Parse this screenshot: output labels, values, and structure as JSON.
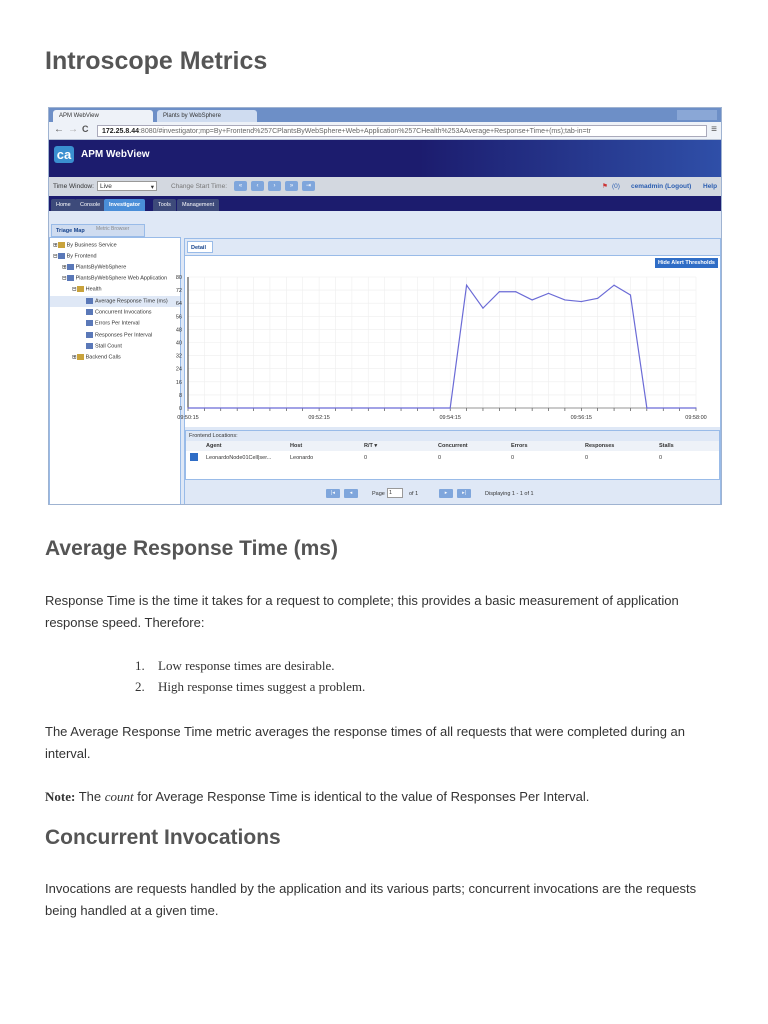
{
  "page_title": "Introscope Metrics",
  "screenshot": {
    "browser_tabs": [
      "APM WebView",
      "Plants by WebSphere"
    ],
    "url_host": "172.25.8.44",
    "url_rest": ":8080/#investigator;mp=By+Frontend%257CPlantsByWebSphere+Web+Application%257CHealth%253AAverage+Response+Time+(ms);tab-in=tr",
    "logo_text": "ca",
    "app_title": "APM WebView",
    "toolbar": {
      "time_window_label": "Time Window:",
      "time_window_value": "Live",
      "change_start_label": "Change Start Time:",
      "alerts": "(0)",
      "user": "cemadmin",
      "logout": "(Logout)",
      "help": "Help"
    },
    "nav_tabs": [
      "Home",
      "Console",
      "Investigator",
      "Tools",
      "Management"
    ],
    "side_tabs": [
      "Triage Map",
      "Metric Browser"
    ],
    "tree": [
      "By Business Service",
      "By Frontend",
      "PlantsByWebSphere",
      "PlantsByWebSphere Web Application",
      "Health",
      "Average Response Time (ms)",
      "Concurrent Invocations",
      "Errors Per Interval",
      "Responses Per Interval",
      "Stall Count",
      "Backend Calls"
    ],
    "detail_tab": "Detail",
    "hide_thresholds": "Hide Alert Thresholds",
    "locations": {
      "title": "Frontend Locations:",
      "columns": [
        "Agent",
        "Host",
        "R/T ▾",
        "Concurrent",
        "Errors",
        "Responses",
        "Stalls"
      ],
      "rows": [
        [
          "LeonardoNode01Cell|ser...",
          "Leonardo",
          "0",
          "0",
          "0",
          "0",
          "0"
        ]
      ]
    },
    "pager": {
      "page_label": "Page",
      "page": "1",
      "of": "of 1",
      "displaying": "Displaying 1 - 1 of 1"
    }
  },
  "chart_data": {
    "type": "line",
    "x_ticks": [
      "09:50:15",
      "09:52:15",
      "09:54:15",
      "09:56:15",
      "09:58:00"
    ],
    "y_ticks": [
      0,
      8,
      16,
      24,
      32,
      40,
      48,
      56,
      64,
      72,
      80
    ],
    "ylim": [
      0,
      80
    ],
    "grid": true,
    "color": "#6b6bd6",
    "x": [
      "09:50:15",
      "09:54:15",
      "09:54:30",
      "09:54:45",
      "09:55:00",
      "09:55:15",
      "09:55:30",
      "09:55:45",
      "09:56:00",
      "09:56:15",
      "09:56:30",
      "09:56:45",
      "09:57:00",
      "09:57:15",
      "09:58:00"
    ],
    "values": [
      0,
      0,
      75,
      61,
      71,
      71,
      66,
      70,
      66,
      65,
      67,
      75,
      69,
      0,
      0
    ]
  },
  "sections": [
    {
      "heading": "Average Response Time (ms)",
      "p1": "Response Time is the time it takes for a request to complete; this provides a basic measurement of application response speed. Therefore:",
      "list": [
        {
          "n": "1.",
          "text": "Low response times are desirable."
        },
        {
          "n": "2.",
          "text": "High response times suggest a problem."
        }
      ],
      "p2": "The Average Response Time metric averages the response times of all requests that were completed during an interval.",
      "note_label": "Note:",
      "note_the": "The",
      "note_em": "count",
      "note_rest": "for Average Response Time is identical to the value of Responses Per Interval."
    },
    {
      "heading": "Concurrent Invocations",
      "p1": "Invocations are requests handled by the application and its various parts; concurrent invocations are the requests being handled at a given time."
    }
  ]
}
